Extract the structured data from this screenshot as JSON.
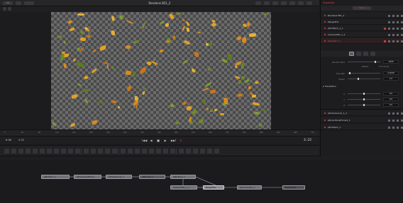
{
  "viewer": {
    "topbar_buttons": [
      "Fit",
      "-"
    ],
    "title": "Renderer3D1_2",
    "ruler_ticks": [
      "0",
      "40",
      "80",
      "120",
      "160",
      "200",
      "240",
      "280",
      "320",
      "360",
      "400",
      "440",
      "480",
      "520",
      "560",
      "600",
      "640",
      "680",
      "720"
    ],
    "tc_start": "0:00",
    "tc_end": "4:23",
    "tc_current": "3:22"
  },
  "transport": {
    "prev_label": "I◀◀",
    "rev_label": "◀",
    "stop_label": "■",
    "play_label": "▶",
    "next_label": "▶▶I",
    "loop_label": "↻"
  },
  "nodes": {
    "pEmitter1": "pEmitter1_1",
    "pDirectionalForce": "pDirectionalForce...",
    "pTurbulence": "pTurbulence1_1",
    "pRender": "pRender1_1",
    "pEmitter2": "pEmitter1_1",
    "camera": "Camera3D1_1_1",
    "merge": "Merge3D1",
    "renderer": "Renderer3D1_2",
    "output": "MediaOut1"
  },
  "inspector": {
    "title": "Inspector",
    "tab_tools": "Tools",
    "tools": [
      {
        "name": "Renderer3D1_2"
      },
      {
        "name": "Merge3D1"
      },
      {
        "name": "pEmitter1_1_1"
      },
      {
        "name": "Camera3D1_1_1"
      },
      {
        "name": "pRender1_1"
      }
    ],
    "params": {
      "render_label": "Render Start",
      "render_value": "2000",
      "render_sub_left": "Restart",
      "render_sub_right": "Time Scale",
      "strength_label": "Strength",
      "strength_value": "0.0030",
      "power_label": "Power",
      "power_value": "2.0"
    },
    "transform_header": "Translation",
    "translation": [
      {
        "label": "X",
        "value": "0.0"
      },
      {
        "label": "Y",
        "value": "0.0"
      },
      {
        "label": "Z",
        "value": "0.0"
      }
    ],
    "lower_tools": [
      {
        "name": "pTurbulence1_1_1"
      },
      {
        "name": "pDirectionalForce2_1"
      },
      {
        "name": "pEmitter1_1"
      }
    ]
  },
  "colors": {
    "accent_red": "#d9433a",
    "leaf_orange": "#d98a1e",
    "leaf_green": "#6e8a2a"
  },
  "icons": {
    "play": "play-icon",
    "stop": "stop-icon",
    "loop": "loop-icon"
  }
}
